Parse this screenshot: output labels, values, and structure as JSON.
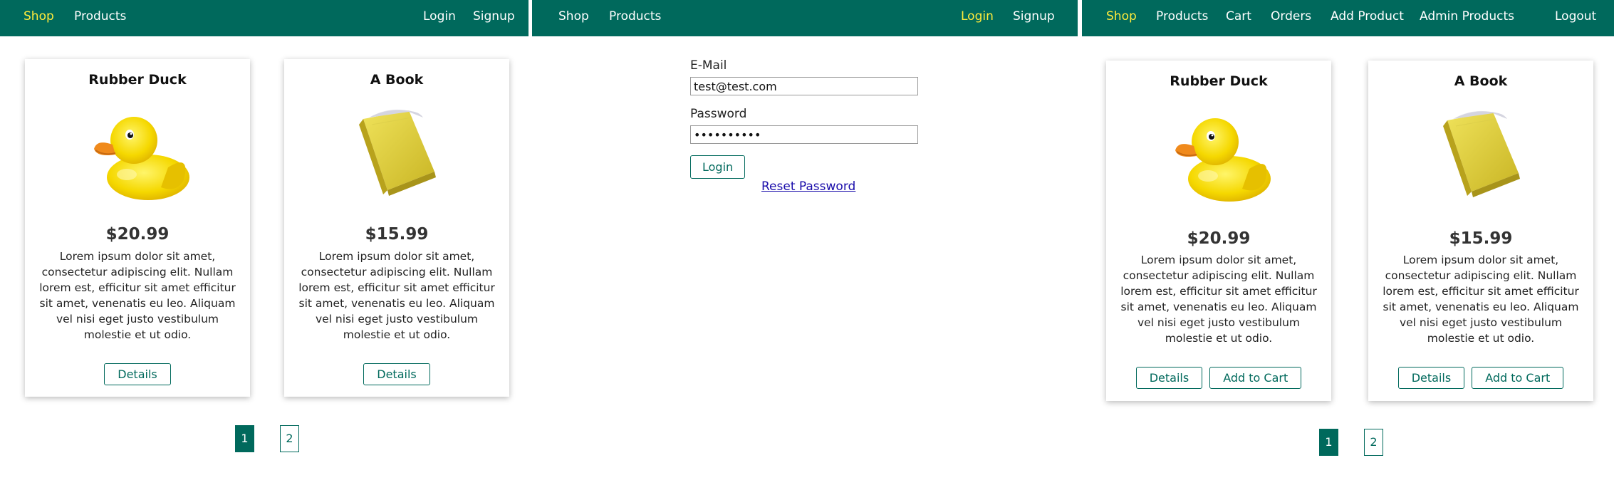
{
  "colors": {
    "brand": "#00695c",
    "active_nav": "#ffeb3b",
    "link": "#1a0dab"
  },
  "panel_shop": {
    "nav": {
      "shop": "Shop",
      "products": "Products",
      "login": "Login",
      "signup": "Signup"
    },
    "products": [
      {
        "title": "Rubber Duck",
        "image": "rubber-duck",
        "price": "$20.99",
        "description": "Lorem ipsum dolor sit amet, consectetur adipiscing elit. Nullam lorem est, efficitur sit amet efficitur sit amet, venenatis eu leo. Aliquam vel nisi eget justo vestibulum molestie et ut odio.",
        "details_label": "Details"
      },
      {
        "title": "A Book",
        "image": "book",
        "price": "$15.99",
        "description": "Lorem ipsum dolor sit amet, consectetur adipiscing elit. Nullam lorem est, efficitur sit amet efficitur sit amet, venenatis eu leo. Aliquam vel nisi eget justo vestibulum molestie et ut odio.",
        "details_label": "Details"
      }
    ],
    "pagination": [
      "1",
      "2"
    ],
    "current_page": "1"
  },
  "panel_login": {
    "nav": {
      "shop": "Shop",
      "products": "Products",
      "login": "Login",
      "signup": "Signup"
    },
    "form": {
      "email_label": "E-Mail",
      "email_value": "test@test.com",
      "password_label": "Password",
      "password_value": "••••••••••",
      "submit_label": "Login",
      "reset_label": "Reset Password"
    }
  },
  "panel_admin": {
    "nav": {
      "shop": "Shop",
      "products": "Products",
      "cart": "Cart",
      "orders": "Orders",
      "add_product": "Add Product",
      "admin_products": "Admin Products",
      "logout": "Logout"
    },
    "products": [
      {
        "title": "Rubber Duck",
        "image": "rubber-duck",
        "price": "$20.99",
        "description": "Lorem ipsum dolor sit amet, consectetur adipiscing elit. Nullam lorem est, efficitur sit amet efficitur sit amet, venenatis eu leo. Aliquam vel nisi eget justo vestibulum molestie et ut odio.",
        "details_label": "Details",
        "cart_label": "Add to Cart"
      },
      {
        "title": "A Book",
        "image": "book",
        "price": "$15.99",
        "description": "Lorem ipsum dolor sit amet, consectetur adipiscing elit. Nullam lorem est, efficitur sit amet efficitur sit amet, venenatis eu leo. Aliquam vel nisi eget justo vestibulum molestie et ut odio.",
        "details_label": "Details",
        "cart_label": "Add to Cart"
      }
    ],
    "pagination": [
      "1",
      "2"
    ],
    "current_page": "1"
  }
}
